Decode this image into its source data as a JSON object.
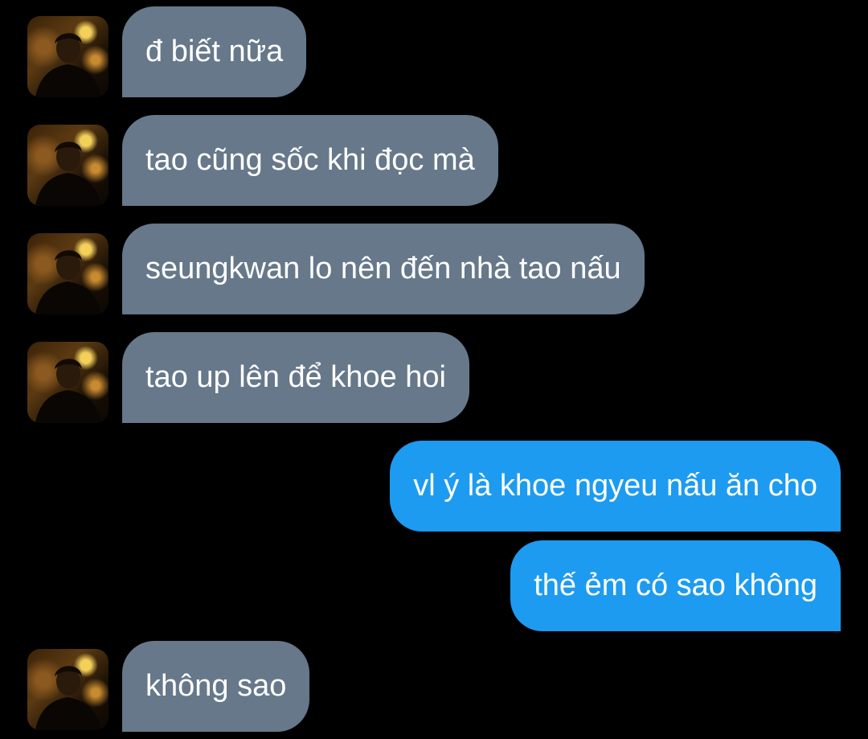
{
  "messages": [
    {
      "direction": "incoming",
      "text": "đ biết nữa"
    },
    {
      "direction": "incoming",
      "text": "tao cũng sốc khi đọc mà"
    },
    {
      "direction": "incoming",
      "text": "seungkwan lo nên đến nhà tao nấu"
    },
    {
      "direction": "incoming",
      "text": "tao up lên để khoe hoi"
    },
    {
      "direction": "outgoing",
      "text": "vl ý là khoe ngyeu nấu ăn cho"
    },
    {
      "direction": "outgoing",
      "text": "thế ẻm có sao không"
    },
    {
      "direction": "incoming",
      "text": "không sao"
    }
  ],
  "colors": {
    "background": "#000000",
    "incoming_bubble": "#66788a",
    "outgoing_bubble": "#1d9bf0",
    "text": "#ffffff"
  },
  "icons": {
    "avatar": "contact-avatar-photo"
  }
}
